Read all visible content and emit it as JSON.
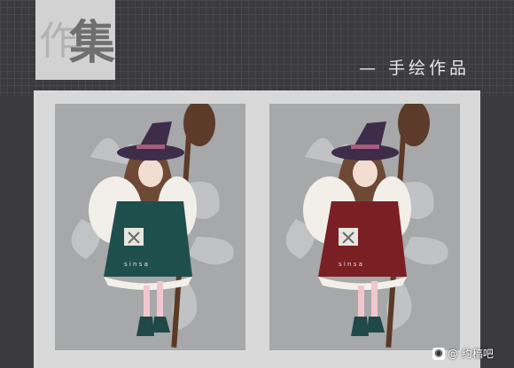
{
  "header": {
    "logo_char_bg": "作",
    "logo_char_fg": "集",
    "subtitle": "— 手绘作品"
  },
  "artworks": [
    {
      "label": "s i n s a",
      "dress_color": "#1f4f4c",
      "variant": "teal"
    },
    {
      "label": "s i n s a",
      "dress_color": "#7a1f24",
      "variant": "red"
    }
  ],
  "watermark": {
    "text": "@ 约稿吧"
  }
}
